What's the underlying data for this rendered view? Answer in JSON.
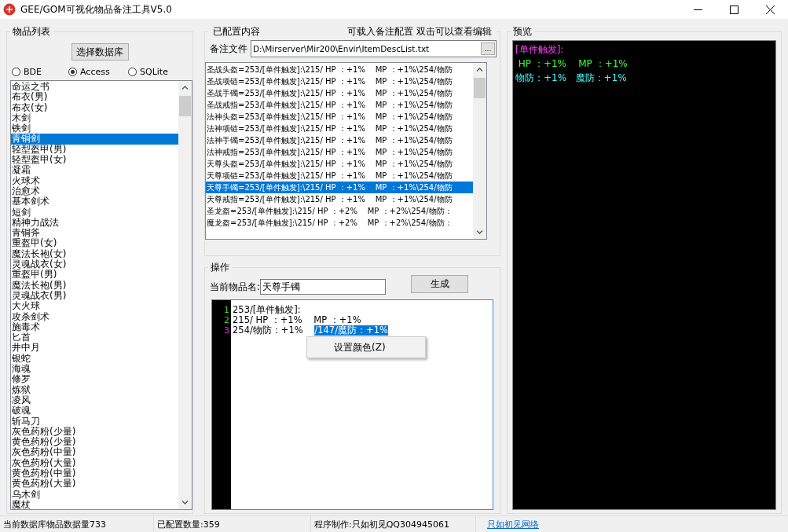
{
  "window": {
    "title": "GEE/GOM可视化物品备注工具V5.0"
  },
  "items_panel": {
    "title": "物品列表",
    "select_button": "选择数据库",
    "db_options": [
      {
        "label": "BDE",
        "selected": false
      },
      {
        "label": "Access",
        "selected": true
      },
      {
        "label": "SQLite",
        "selected": false
      }
    ],
    "items": [
      {
        "label": "命运之书",
        "selected": false
      },
      {
        "label": "布衣(男)",
        "selected": false
      },
      {
        "label": "布衣(女)",
        "selected": false
      },
      {
        "label": "木剑",
        "selected": false
      },
      {
        "label": "铁剑",
        "selected": false
      },
      {
        "label": "青铜剑",
        "selected": true
      },
      {
        "label": "轻型盔甲(男)",
        "selected": false
      },
      {
        "label": "轻型盔甲(女)",
        "selected": false
      },
      {
        "label": "凝霜",
        "selected": false
      },
      {
        "label": "火球术",
        "selected": false
      },
      {
        "label": "治愈术",
        "selected": false
      },
      {
        "label": "基本剑术",
        "selected": false
      },
      {
        "label": "短剑",
        "selected": false
      },
      {
        "label": "精神力战法",
        "selected": false
      },
      {
        "label": "青铜斧",
        "selected": false
      },
      {
        "label": "重盔甲(女)",
        "selected": false
      },
      {
        "label": "魔法长袍(女)",
        "selected": false
      },
      {
        "label": "灵魂战衣(女)",
        "selected": false
      },
      {
        "label": "重盔甲(男)",
        "selected": false
      },
      {
        "label": "魔法长袍(男)",
        "selected": false
      },
      {
        "label": "灵魂战衣(男)",
        "selected": false
      },
      {
        "label": "大火球",
        "selected": false
      },
      {
        "label": "攻杀剑术",
        "selected": false
      },
      {
        "label": "施毒术",
        "selected": false
      },
      {
        "label": "匕首",
        "selected": false
      },
      {
        "label": "井中月",
        "selected": false
      },
      {
        "label": "银蛇",
        "selected": false
      },
      {
        "label": "海魂",
        "selected": false
      },
      {
        "label": "修罗",
        "selected": false
      },
      {
        "label": "炼狱",
        "selected": false
      },
      {
        "label": "凌风",
        "selected": false
      },
      {
        "label": "破魂",
        "selected": false
      },
      {
        "label": "斩马刀",
        "selected": false
      },
      {
        "label": "灰色药粉(少量)",
        "selected": false
      },
      {
        "label": "黄色药粉(少量)",
        "selected": false
      },
      {
        "label": "灰色药粉(中量)",
        "selected": false
      },
      {
        "label": "灰色药粉(大量)",
        "selected": false
      },
      {
        "label": "黄色药粉(中量)",
        "selected": false
      },
      {
        "label": "黄色药粉(大量)",
        "selected": false
      },
      {
        "label": "乌木剑",
        "selected": false
      },
      {
        "label": "魔杖",
        "selected": false
      }
    ]
  },
  "config_panel": {
    "title": "已配置内容",
    "hint": "可载入备注配置 双击可以查看编辑",
    "file_label": "备注文件",
    "file_path": "D:\\Mirserver\\Mir200\\Envir\\ItemDescList.txt",
    "browse_button": "...",
    "rows": [
      {
        "text": "圣战头盔=253/[单件触发]:\\215/ HP ：+1%    MP ：+1%\\254/物防",
        "selected": false
      },
      {
        "text": "圣战项链=253/[单件触发]:\\215/ HP ：+1%    MP ：+1%\\254/物防",
        "selected": false
      },
      {
        "text": "圣战手镯=253/[单件触发]:\\215/ HP ：+1%    MP ：+1%\\254/物防",
        "selected": false
      },
      {
        "text": "圣战戒指=253/[单件触发]:\\215/ HP ：+1%    MP ：+1%\\254/物防",
        "selected": false
      },
      {
        "text": "法神头盔=253/[单件触发]:\\215/ HP ：+1%    MP ：+1%\\254/物防",
        "selected": false
      },
      {
        "text": "法神项链=253/[单件触发]:\\215/ HP ：+1%    MP ：+1%\\254/物防",
        "selected": false
      },
      {
        "text": "法神手镯=253/[单件触发]:\\215/ HP ：+1%    MP ：+1%\\254/物防",
        "selected": false
      },
      {
        "text": "法神戒指=253/[单件触发]:\\215/ HP ：+1%    MP ：+1%\\254/物防",
        "selected": false
      },
      {
        "text": "天尊头盔=253/[单件触发]:\\215/ HP ：+1%    MP ：+1%\\254/物防",
        "selected": false
      },
      {
        "text": "天尊项链=253/[单件触发]:\\215/ HP ：+1%    MP ：+1%\\254/物防",
        "selected": false
      },
      {
        "text": "天尊手镯=253/[单件触发]:\\215/ HP ：+1%    MP ：+1%\\254/物防",
        "selected": true
      },
      {
        "text": "天尊戒指=253/[单件触发]:\\215/ HP ：+1%    MP ：+1%\\254/物防",
        "selected": false
      },
      {
        "text": "圣龙盔=253/[单件触发]:\\215/ HP ：+2%    MP ：+2%\\254/物防：",
        "selected": false
      },
      {
        "text": "魔龙盔=253/[单件触发]:\\215/ HP ：+2%    MP ：+2%\\254/物防：",
        "selected": false
      }
    ]
  },
  "operation_panel": {
    "title": "操作",
    "name_label": "当前物品名:",
    "name_value": "天尊手镯",
    "generate_button": "生成",
    "editor_lines": [
      {
        "number": "1",
        "color": "#40d040",
        "segments": [
          {
            "text": "253/[单件触发]:",
            "selected": false
          }
        ]
      },
      {
        "number": "2",
        "color": "#40d040",
        "segments": [
          {
            "text": "215/ HP ：+1%    MP ：+1%",
            "selected": false
          }
        ]
      },
      {
        "number": "3",
        "color": "#e020e0",
        "segments": [
          {
            "text": "254/物防：+1%    ",
            "selected": false
          },
          {
            "text": "/147/魔防：+1%",
            "selected": true
          }
        ]
      }
    ],
    "context_menu": [
      "设置颜色(Z)"
    ]
  },
  "preview_panel": {
    "title": "预览",
    "lines": [
      [
        {
          "text": "[单件触发]:",
          "color": "#ff40ff"
        }
      ],
      [
        {
          "text": " HP ：+1%    MP ：+1%",
          "color": "#40ff40"
        }
      ],
      [
        {
          "text": "物防：+1%   魔防：+1%",
          "color": "#40ffff"
        }
      ]
    ]
  },
  "status_bar": {
    "item_count": "当前数据库物品数据量733",
    "configured_count": "已配置数量:359",
    "author": "程序制作:只如初见QQ304945061",
    "link": "只如初见网络"
  }
}
